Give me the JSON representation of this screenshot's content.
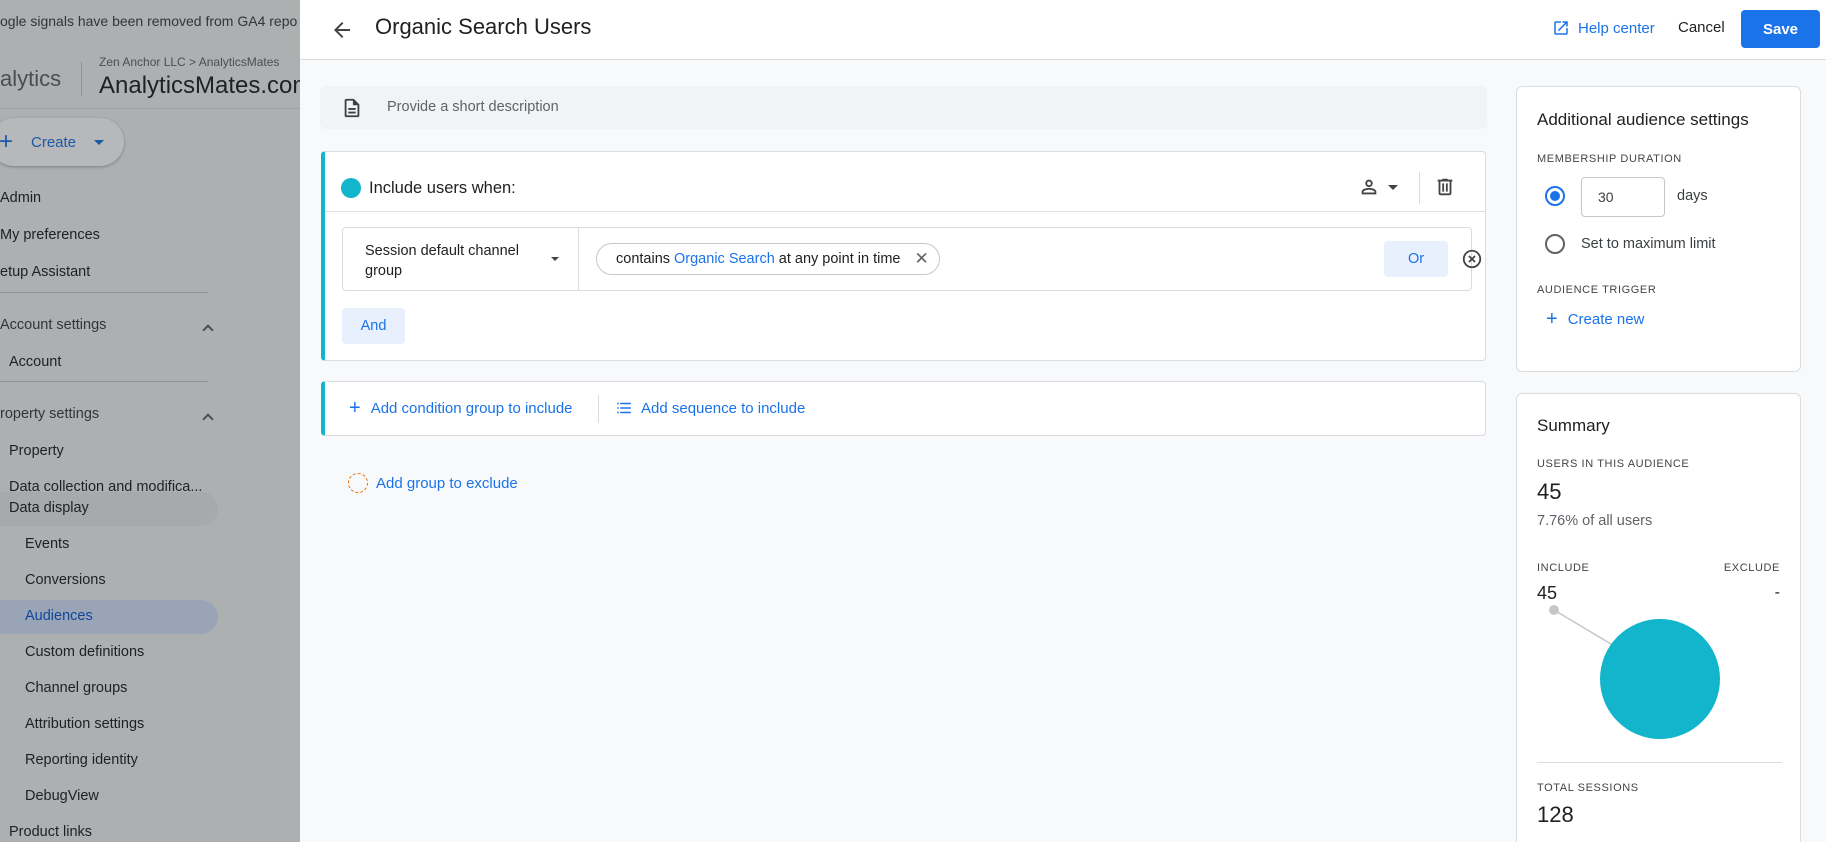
{
  "background": {
    "banner_text": "ogle signals have been removed from GA4 repo",
    "brand": "alytics",
    "breadcrumb": "Zen Anchor LLC > AnalyticsMates",
    "account_name": "AnalyticsMates.com",
    "create_label": "Create",
    "nav": {
      "admin": "Admin",
      "my_preferences": "My preferences",
      "setup_assistant": "etup Assistant",
      "account_settings": "Account settings",
      "account": "Account",
      "property_settings": "roperty settings",
      "property": "Property",
      "data_collection": "Data collection and modifica...",
      "data_display": "Data display",
      "events": "Events",
      "conversions": "Conversions",
      "audiences": "Audiences",
      "custom_definitions": "Custom definitions",
      "channel_groups": "Channel groups",
      "attribution_settings": "Attribution settings",
      "reporting_identity": "Reporting identity",
      "debugview": "DebugView",
      "product_links": "Product links"
    }
  },
  "header": {
    "title": "Organic Search Users",
    "help_label": "Help center",
    "cancel_label": "Cancel",
    "save_label": "Save"
  },
  "description": {
    "placeholder": "Provide a short description"
  },
  "include_group": {
    "title": "Include users when:",
    "condition": {
      "dimension": "Session default channel group",
      "operator": "contains",
      "value": "Organic Search",
      "time_scope": "at any point in time"
    },
    "or_label": "Or",
    "and_label": "And"
  },
  "add_actions": {
    "add_condition_group": "Add condition group to include",
    "add_sequence": "Add sequence to include",
    "add_exclude": "Add group to exclude"
  },
  "settings": {
    "title": "Additional audience settings",
    "membership_label": "MEMBERSHIP DURATION",
    "duration_value": "30",
    "days_label": "days",
    "max_limit_label": "Set to maximum limit",
    "trigger_label": "AUDIENCE TRIGGER",
    "create_new_label": "Create new"
  },
  "summary": {
    "title": "Summary",
    "users_label": "USERS IN THIS AUDIENCE",
    "users_value": "45",
    "users_pct": "7.76% of all users",
    "include_label": "INCLUDE",
    "exclude_label": "EXCLUDE",
    "include_value": "45",
    "exclude_value": "-",
    "sessions_label": "TOTAL SESSIONS",
    "sessions_value": "128"
  },
  "colors": {
    "accent": "#1a73e8",
    "include_teal": "#12b5cb",
    "exclude_orange": "#e8710a"
  }
}
